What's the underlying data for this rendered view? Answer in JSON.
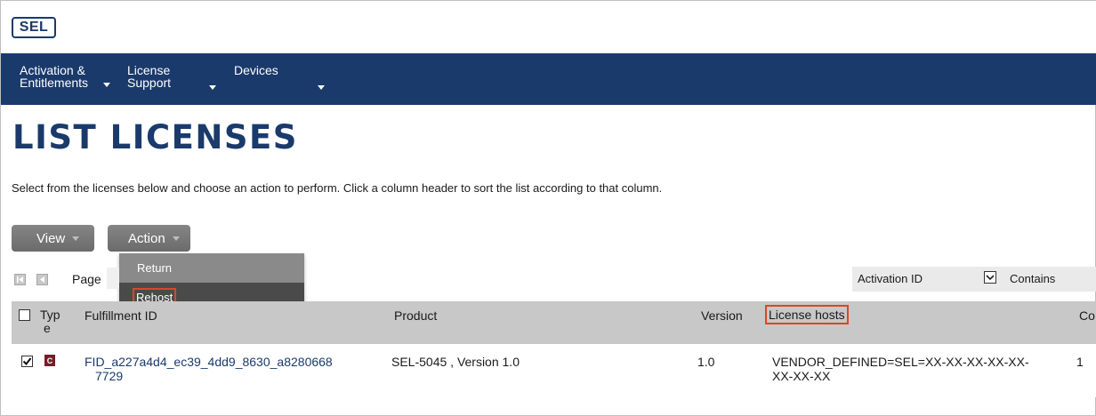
{
  "header": {
    "logo_text": "SEL"
  },
  "nav": {
    "items": [
      {
        "line1": "Activation &",
        "line2": "Entitlements"
      },
      {
        "line1": "License",
        "line2": "Support"
      },
      {
        "line1": "Devices",
        "line2": ""
      }
    ]
  },
  "page": {
    "title": "LIST LICENSES",
    "instructions": "Select from the licenses below and choose an action to perform. Click a column header to sort the list according to that column."
  },
  "toolbar": {
    "view_label": "View",
    "action_label": "Action"
  },
  "action_menu": {
    "items": [
      "Return",
      "Rehost"
    ]
  },
  "pager": {
    "page_label": "Page"
  },
  "filter": {
    "field": "Activation ID",
    "operator": "Contains"
  },
  "table": {
    "headers": [
      "Typ",
      "e",
      "Fulfillment ID",
      "Product",
      "Version",
      "License hosts",
      "Co"
    ],
    "rows": [
      {
        "checked": true,
        "type_icon": "C",
        "fulfillment_id_line1": "FID_a227a4d4_ec39_4dd9_8630_a8280668",
        "fulfillment_id_line2": "7729",
        "product": "SEL-5045 , Version 1.0",
        "version": "1.0",
        "license_hosts_line1": "VENDOR_DEFINED=SEL=XX-XX-XX-XX-XX-",
        "license_hosts_line2": "XX-XX-XX",
        "count": "1"
      }
    ]
  },
  "colors": {
    "brand": "#1a3a6b",
    "highlight": "#d9462b",
    "type_icon": "#7a1b28"
  }
}
